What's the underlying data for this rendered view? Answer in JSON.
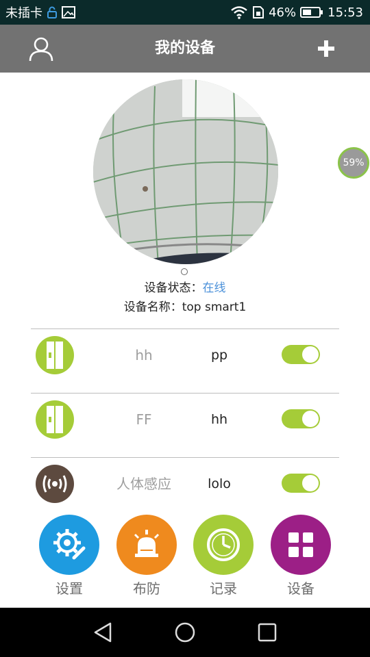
{
  "status_bar": {
    "carrier": "未插卡",
    "battery_percent": "46%",
    "time": "15:53"
  },
  "header": {
    "title": "我的设备"
  },
  "camera": {
    "badge": "59%"
  },
  "device_info": {
    "status_label": "设备状态：",
    "status_value": "在线",
    "name_label": "设备名称：",
    "name_value": "top smart1"
  },
  "sensors": [
    {
      "icon": "door-sensor-icon",
      "name": "hh",
      "zone": "pp",
      "enabled": true,
      "icon_color": "#a5cc38"
    },
    {
      "icon": "door-sensor-icon",
      "name": "FF",
      "zone": "hh",
      "enabled": true,
      "icon_color": "#a5cc38"
    },
    {
      "icon": "motion-sensor-icon",
      "name": "人体感应",
      "zone": "lolo",
      "enabled": true,
      "icon_color": "#5d4a3f"
    }
  ],
  "bottom_nav": [
    {
      "label": "设置",
      "icon": "settings-icon",
      "color": "#1e9be0"
    },
    {
      "label": "布防",
      "icon": "alarm-icon",
      "color": "#ef8a1e"
    },
    {
      "label": "记录",
      "icon": "clock-icon",
      "color": "#a5cc38"
    },
    {
      "label": "设备",
      "icon": "devices-grid-icon",
      "color": "#9c1f86"
    }
  ],
  "colors": {
    "header_bg": "#727272",
    "status_online": "#4a90d9",
    "toggle_on": "#a5cc38"
  }
}
